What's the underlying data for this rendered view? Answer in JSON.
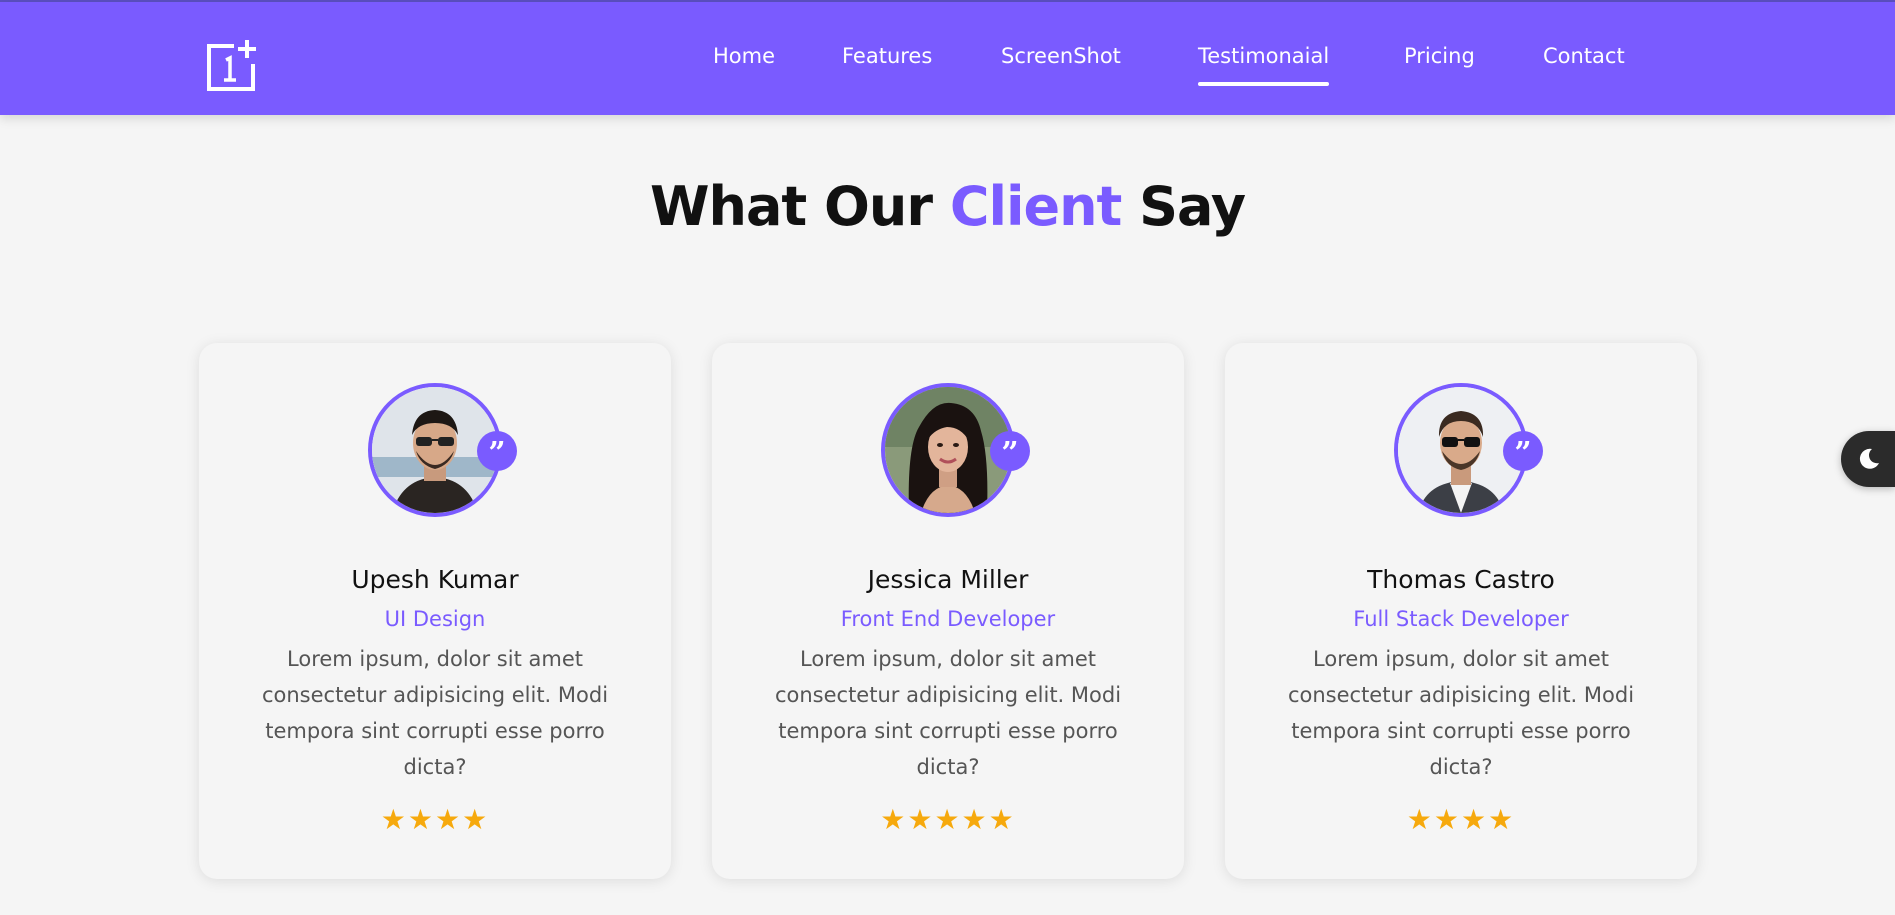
{
  "nav": {
    "logo_icon": "oneplus-logo-icon",
    "links": [
      {
        "label": "Home",
        "active": false
      },
      {
        "label": "Features",
        "active": false
      },
      {
        "label": "ScreenShot",
        "active": false
      },
      {
        "label": "Testimonaial",
        "active": true
      },
      {
        "label": "Pricing",
        "active": false
      },
      {
        "label": "Contact",
        "active": false
      }
    ]
  },
  "section": {
    "title_before": "What Our",
    "title_accent": "Client",
    "title_after": "Say"
  },
  "testimonials": [
    {
      "name": "Upesh Kumar",
      "role": "UI Design",
      "text": "Lorem ipsum, dolor sit amet consectetur adipisicing elit. Modi tempora sint corrupti esse porro dicta?",
      "rating": 4,
      "quote_icon": "quote-icon"
    },
    {
      "name": "Jessica Miller",
      "role": "Front End Developer",
      "text": "Lorem ipsum, dolor sit amet consectetur adipisicing elit. Modi tempora sint corrupti esse porro dicta?",
      "rating": 5,
      "quote_icon": "quote-icon"
    },
    {
      "name": "Thomas Castro",
      "role": "Full Stack Developer",
      "text": "Lorem ipsum, dolor sit amet consectetur adipisicing elit. Modi tempora sint corrupti esse porro dicta?",
      "rating": 4,
      "quote_icon": "quote-icon"
    }
  ],
  "theme_toggle": {
    "icon": "moon-icon"
  },
  "colors": {
    "accent": "#7a5bff",
    "star": "#f6a90d",
    "background": "#f5f5f5"
  }
}
